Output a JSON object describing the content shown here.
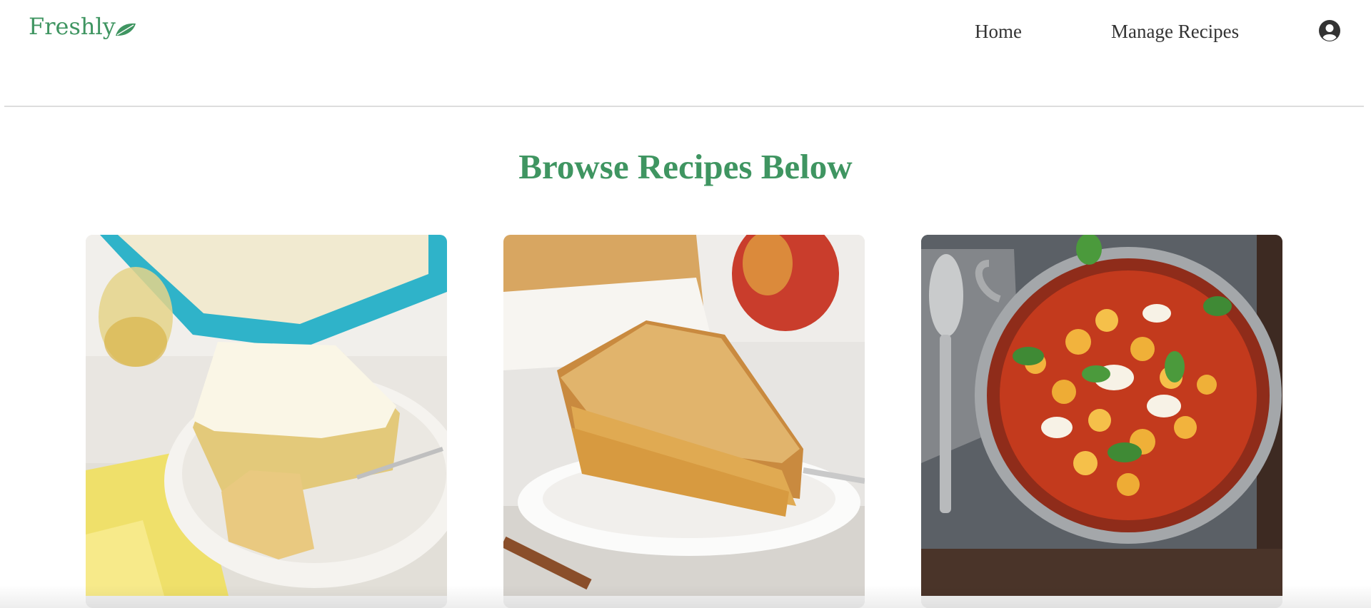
{
  "brand": {
    "name": "Freshly",
    "color": "#3f9561"
  },
  "nav": {
    "items": [
      {
        "label": "Home"
      },
      {
        "label": "Manage Recipes"
      }
    ],
    "account_icon": "account-circle-icon"
  },
  "main": {
    "heading": "Browse Recipes Below",
    "recipes": [
      {
        "image": "frosted-cake-slice-photo"
      },
      {
        "image": "apple-pie-slice-photo"
      },
      {
        "image": "baked-gnocchi-pan-photo"
      }
    ]
  }
}
